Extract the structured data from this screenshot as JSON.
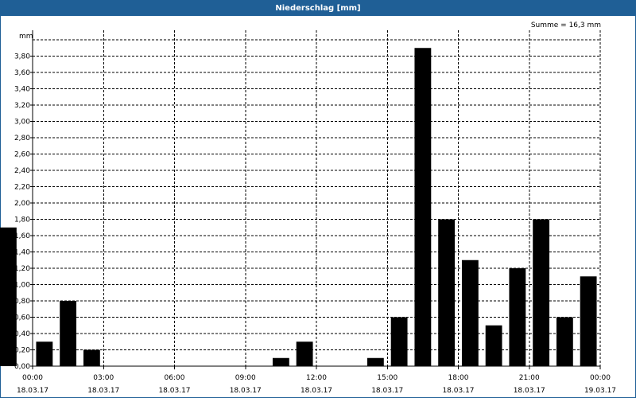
{
  "window": {
    "title": "Niederschlag [mm]"
  },
  "summary": "Summe = 16,3 mm",
  "chart_data": {
    "type": "bar",
    "title": "Niederschlag [mm]",
    "ylabel": "mm",
    "xlabel": "",
    "ylim": [
      0,
      4.0
    ],
    "yticks": [
      0,
      0.2,
      0.4,
      0.6,
      0.8,
      1.0,
      1.2,
      1.4,
      1.6,
      1.8,
      2.0,
      2.2,
      2.4,
      2.6,
      2.8,
      3.0,
      3.2,
      3.4,
      3.6,
      3.8
    ],
    "ytick_labels": [
      "0,00",
      "0,20",
      "0,40",
      "0,60",
      "0,80",
      "1,00",
      "1,20",
      "1,40",
      "1,60",
      "1,80",
      "2,00",
      "2,20",
      "2,40",
      "2,60",
      "2,80",
      "3,00",
      "3,20",
      "3,40",
      "3,60",
      "3,80"
    ],
    "xlim": [
      0,
      24
    ],
    "xticks": [
      0,
      3,
      6,
      9,
      12,
      15,
      18,
      21,
      24
    ],
    "xtick_labels": [
      {
        "time": "00:00",
        "date": "18.03.17"
      },
      {
        "time": "03:00",
        "date": "18.03.17"
      },
      {
        "time": "06:00",
        "date": "18.03.17"
      },
      {
        "time": "09:00",
        "date": "18.03.17"
      },
      {
        "time": "12:00",
        "date": "18.03.17"
      },
      {
        "time": "15:00",
        "date": "18.03.17"
      },
      {
        "time": "18:00",
        "date": "18.03.17"
      },
      {
        "time": "21:00",
        "date": "18.03.17"
      },
      {
        "time": "00:00",
        "date": "19.03.17"
      }
    ],
    "grid": true,
    "bar_color": "#000000",
    "x": [
      0,
      1,
      2,
      3,
      4,
      5,
      6,
      7,
      8,
      9,
      10,
      11,
      12,
      13,
      14,
      15,
      16,
      17,
      18,
      19,
      20,
      21,
      22,
      23
    ],
    "values": [
      0.3,
      0.8,
      0.2,
      0,
      0,
      0,
      0,
      0,
      0,
      0,
      0.1,
      0.3,
      0,
      0,
      0.1,
      0.6,
      3.9,
      1.8,
      1.3,
      0.5,
      1.2,
      1.8,
      0.6,
      1.1,
      1.7
    ]
  }
}
